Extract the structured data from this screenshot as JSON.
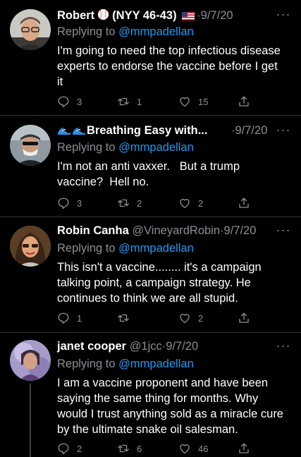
{
  "tweets": [
    {
      "name_prefix": "Robert",
      "name_suffix": "(NYY 46-43)",
      "handle": "",
      "date": "9/7/20",
      "replying_prefix": "Replying to",
      "replying_to": "@mmpadellan",
      "text": "I'm going to need the top infectious disease experts to endorse the vaccine before I get it",
      "reply_count": "3",
      "retweet_count": "1",
      "like_count": "15"
    },
    {
      "name_prefix": "",
      "name_suffix": "Breathing Easy with...",
      "handle": "",
      "date": "9/7/20",
      "replying_prefix": "Replying to",
      "replying_to": "@mmpadellan",
      "text": "I'm not an anti vaxxer.   But a trump vaccine?  Hell no.",
      "reply_count": "3",
      "retweet_count": "2",
      "like_count": "2"
    },
    {
      "name_prefix": "Robin Canha",
      "name_suffix": "",
      "handle": "@VineyardRobin",
      "date": "9/7/20",
      "replying_prefix": "Replying to",
      "replying_to": "@mmpadellan",
      "text": "This isn't a vaccine........ it's a campaign talking point, a campaign strategy. He continues to think we are all stupid.",
      "reply_count": "1",
      "retweet_count": "",
      "like_count": "2"
    },
    {
      "name_prefix": "janet cooper",
      "name_suffix": "",
      "handle": "@1jcc",
      "date": "9/7/20",
      "replying_prefix": "Replying to",
      "replying_to": "@mmpadellan",
      "text": "I am a vaccine proponent and have been saying  the same thing for months.  Why would I trust anything sold as a miracle cure by the ultimate snake oil salesman.",
      "reply_count": "2",
      "retweet_count": "6",
      "like_count": "46"
    }
  ],
  "colors": {
    "background": "#000000",
    "text": "#ffffff",
    "secondary": "#8b8f94",
    "link": "#1d9bf0",
    "divider": "#2f3336"
  },
  "icons": [
    "baseball-icon",
    "us-flag-icon",
    "wave-icon",
    "more-icon",
    "reply-icon",
    "retweet-icon",
    "like-icon",
    "share-icon"
  ]
}
